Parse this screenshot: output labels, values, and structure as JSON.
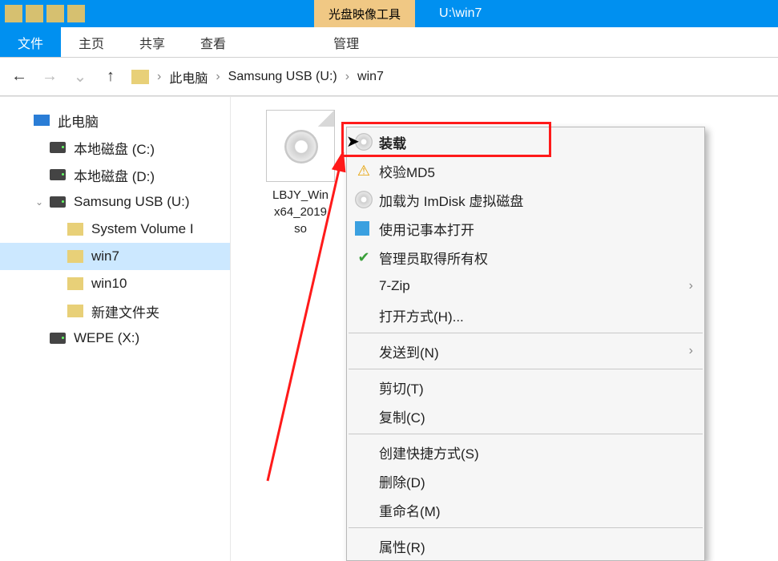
{
  "titleBar": {
    "toolTab": "光盘映像工具",
    "windowTitle": "U:\\win7"
  },
  "ribbon": {
    "file": "文件",
    "home": "主页",
    "share": "共享",
    "view": "查看",
    "manage": "管理"
  },
  "breadcrumb": {
    "items": [
      "此电脑",
      "Samsung USB (U:)",
      "win7"
    ]
  },
  "tree": {
    "thisPc": "此电脑",
    "driveC": "本地磁盘 (C:)",
    "driveD": "本地磁盘 (D:)",
    "samsung": "Samsung USB (U:)",
    "sysVol": "System Volume I",
    "win7": "win7",
    "win10": "win10",
    "newFolder": "新建文件夹",
    "wepe": "WEPE (X:)"
  },
  "file": {
    "line1": "LBJY_Win",
    "line2": "x64_2019",
    "line3": "so"
  },
  "contextMenu": {
    "mount": "装载",
    "checkMd5": "校验MD5",
    "imdisk": "加载为 ImDisk 虚拟磁盘",
    "notepad": "使用记事本打开",
    "adminOwn": "管理员取得所有权",
    "sevenZip": "7-Zip",
    "openWith": "打开方式(H)...",
    "sendTo": "发送到(N)",
    "cut": "剪切(T)",
    "copy": "复制(C)",
    "shortcut": "创建快捷方式(S)",
    "delete": "删除(D)",
    "rename": "重命名(M)",
    "properties": "属性(R)"
  }
}
